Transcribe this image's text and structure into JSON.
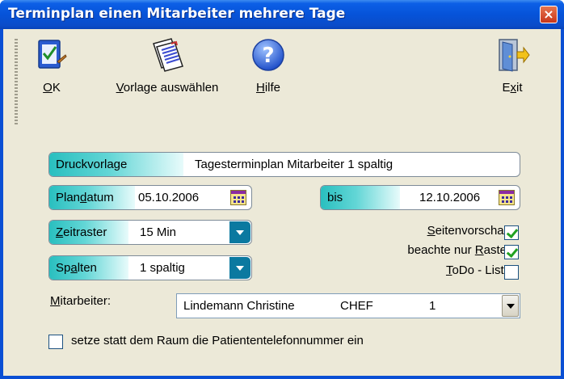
{
  "window": {
    "title": "Terminplan einen Mitarbeiter mehrere Tage",
    "close_glyph": "×"
  },
  "toolbar": {
    "ok": {
      "pre": "",
      "key": "O",
      "post": "K",
      "icon": "checklist-icon"
    },
    "vorlage": {
      "pre": "",
      "key": "V",
      "post": "orlage auswählen",
      "icon": "documents-icon"
    },
    "hilfe": {
      "pre": "",
      "key": "H",
      "post": "ilfe",
      "icon": "help-icon"
    },
    "exit": {
      "pre": "E",
      "key": "x",
      "post": "it",
      "icon": "exit-door-icon"
    }
  },
  "form": {
    "druckvorlage": {
      "label": "Druckvorlage",
      "value": "Tagesterminplan Mitarbeiter 1 spaltig"
    },
    "plandatum": {
      "label_pre": "Plan",
      "label_key": "d",
      "label_post": "atum",
      "value": "05.10.2006"
    },
    "bis": {
      "label": "bis",
      "value": "12.10.2006"
    },
    "zeitraster": {
      "label_pre": "",
      "label_key": "Z",
      "label_post": "eitraster",
      "value": "15 Min"
    },
    "spalten": {
      "label_pre": "Sp",
      "label_key": "a",
      "label_post": "lten",
      "value": "1 spaltig"
    },
    "seitenvorschau": {
      "label_pre": "",
      "label_key": "S",
      "label_post": "eitenvorschau",
      "checked": true
    },
    "nur_raster": {
      "label_pre": "beachte nur ",
      "label_key": "R",
      "label_post": "aster",
      "checked": true
    },
    "todo": {
      "label_pre": "",
      "label_key": "T",
      "label_post": "oDo - Liste",
      "checked": false
    },
    "mitarbeiter": {
      "label_pre": "",
      "label_key": "M",
      "label_post": "itarbeiter:",
      "name": "Lindemann Christine",
      "kuerzel": "CHEF",
      "nr": "1"
    },
    "telefon": {
      "label": "setze statt dem Raum die Patiententelefonnummer ein",
      "checked": false
    }
  },
  "colors": {
    "title_bar": "#0653d9",
    "caption_gradient_start": "#29bfbf",
    "dropdown_arrow": "#0b79a0",
    "window_face": "#ece9d8"
  }
}
